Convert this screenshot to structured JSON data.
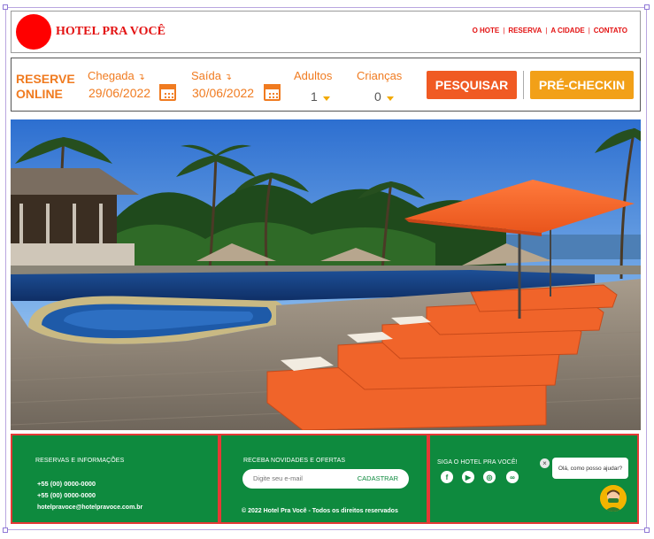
{
  "header": {
    "brand": "HOTEL PRA VOCÊ",
    "nav": [
      "O HOTE",
      "RESERVA",
      "A CIDADE",
      "CONTATO"
    ]
  },
  "booking": {
    "title_line1": "RESERVE",
    "title_line2": "ONLINE",
    "checkin_label": "Chegada",
    "checkin_date": "29/06/2022",
    "checkout_label": "Saída",
    "checkout_date": "30/06/2022",
    "adults_label": "Adultos",
    "adults_value": "1",
    "children_label": "Crianças",
    "children_value": "0",
    "search_button": "PESQUISAR",
    "precheckin_button": "PRÉ-CHECKIN",
    "arrow_glyph": "↴",
    "calendar_icon": "calendar-icon",
    "caret_icon": "caret-down-icon"
  },
  "footer": {
    "contact_title": "RESERVAS E INFORMAÇÕES",
    "phone1": "+55 (00) 0000-0000",
    "phone2": "+55 (00) 0000-0000",
    "email": "hotelpravoce@hotelpravoce.com.br",
    "newsletter_title": "RECEBA NOVIDADES E OFERTAS",
    "newsletter_placeholder": "Digite seu e-mail",
    "newsletter_button": "CADASTRAR",
    "copyright": "© 2022 Hotel Pra Você - Todos os direitos reservados",
    "social_title": "SIGA O HOTEL PRA VOCÊ!",
    "social_icons": [
      "facebook-icon",
      "youtube-icon",
      "instagram-icon",
      "tripadvisor-icon"
    ],
    "chat_message": "Olá, como posso ajudar?",
    "chat_close": "×"
  },
  "colors": {
    "brand_red": "#e31212",
    "orange": "#f07b20",
    "search_orange": "#f05a23",
    "precheckin_yellow": "#f2a018",
    "footer_green": "#0e8a3e",
    "footer_border": "#e53935"
  }
}
